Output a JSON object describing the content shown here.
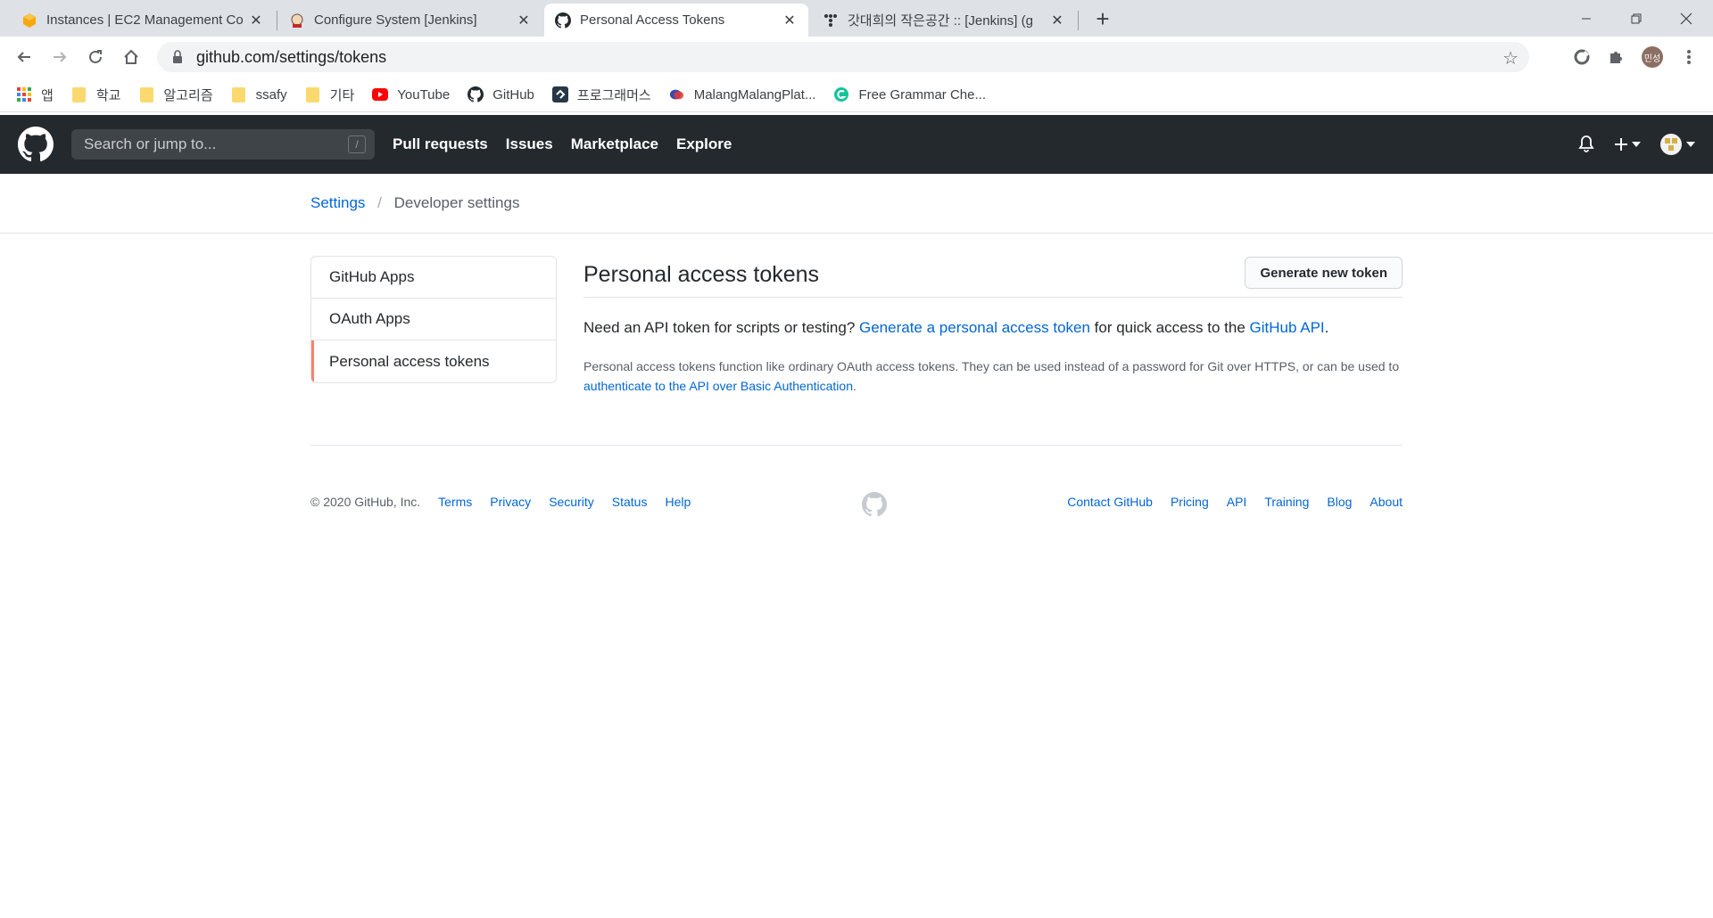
{
  "browser": {
    "tabs": [
      {
        "title": "Instances | EC2 Management Co",
        "icon": "aws-icon"
      },
      {
        "title": "Configure System [Jenkins]",
        "icon": "jenkins-icon"
      },
      {
        "title": "Personal Access Tokens",
        "icon": "github-icon",
        "active": true
      },
      {
        "title": "갓대희의 작은공간 :: [Jenkins] (g",
        "icon": "tistory-icon"
      }
    ],
    "url": "github.com/settings/tokens",
    "profile_initials": "민성",
    "bookmarks": [
      {
        "label": "앱",
        "icon": "apps-grid-icon"
      },
      {
        "label": "학교",
        "icon": "folder-icon"
      },
      {
        "label": "알고리즘",
        "icon": "folder-icon"
      },
      {
        "label": "ssafy",
        "icon": "folder-icon"
      },
      {
        "label": "기타",
        "icon": "folder-icon"
      },
      {
        "label": "YouTube",
        "icon": "youtube-icon"
      },
      {
        "label": "GitHub",
        "icon": "github-icon"
      },
      {
        "label": "프로그래머스",
        "icon": "programmers-icon"
      },
      {
        "label": "MalangMalangPlat...",
        "icon": "malang-icon"
      },
      {
        "label": "Free Grammar Che...",
        "icon": "grammar-icon"
      }
    ]
  },
  "header": {
    "search_placeholder": "Search or jump to...",
    "search_shortcut": "/",
    "nav": [
      "Pull requests",
      "Issues",
      "Marketplace",
      "Explore"
    ]
  },
  "breadcrumb": {
    "root": "Settings",
    "separator": "/",
    "current": "Developer settings"
  },
  "sidebar": {
    "items": [
      {
        "label": "GitHub Apps"
      },
      {
        "label": "OAuth Apps"
      },
      {
        "label": "Personal access tokens",
        "selected": true
      }
    ]
  },
  "main": {
    "title": "Personal access tokens",
    "generate_button": "Generate new token",
    "lead_prefix": "Need an API token for scripts or testing? ",
    "lead_link": "Generate a personal access token",
    "lead_middle": " for quick access to the ",
    "lead_api_link": "GitHub API",
    "lead_suffix": ".",
    "note_text": "Personal access tokens function like ordinary OAuth access tokens. They can be used instead of a password for Git over HTTPS, or can be used to ",
    "note_link": "authenticate to the API over Basic Authentication",
    "note_suffix": "."
  },
  "footer": {
    "copyright": "© 2020 GitHub, Inc.",
    "left_links": [
      "Terms",
      "Privacy",
      "Security",
      "Status",
      "Help"
    ],
    "right_links": [
      "Contact GitHub",
      "Pricing",
      "API",
      "Training",
      "Blog",
      "About"
    ]
  },
  "colors": {
    "header_bg": "#24292e",
    "link": "#0366d6",
    "selected_accent": "#f9826c"
  }
}
